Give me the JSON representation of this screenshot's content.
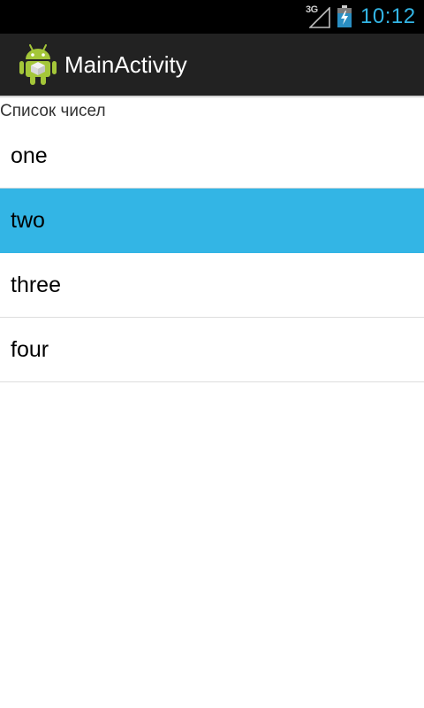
{
  "status_bar": {
    "network_type": "3G",
    "time": "10:12",
    "signal_icon": "signal-icon",
    "battery_icon": "battery-charging-icon"
  },
  "action_bar": {
    "title": "MainActivity",
    "app_icon": "android-robot-icon"
  },
  "list": {
    "header": "Список чисел",
    "items": [
      {
        "label": "one",
        "selected": false
      },
      {
        "label": "two",
        "selected": true
      },
      {
        "label": "three",
        "selected": false
      },
      {
        "label": "four",
        "selected": false
      }
    ]
  },
  "colors": {
    "status_bar_bg": "#000000",
    "action_bar_bg": "#222222",
    "accent": "#33b5e5",
    "divider": "#dddddd",
    "icon_green": "#a4c639"
  }
}
